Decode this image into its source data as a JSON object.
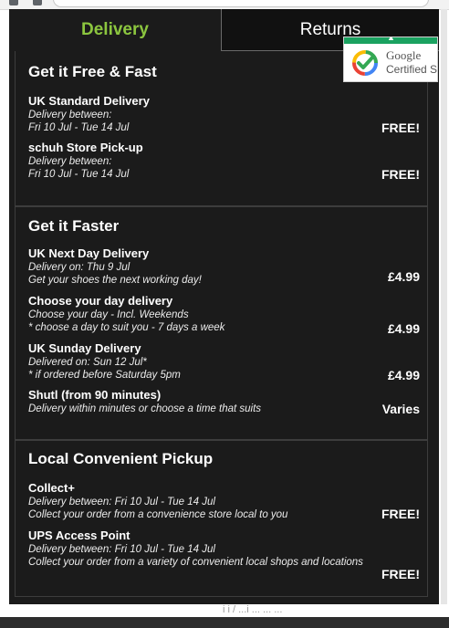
{
  "tabs": {
    "delivery": "Delivery",
    "returns": "Returns"
  },
  "badge": {
    "line1": "Google",
    "line2": "Certified Sh"
  },
  "sections": [
    {
      "title": "Get it Free & Fast",
      "options": [
        {
          "name": "UK Standard Delivery",
          "lines": [
            "Delivery between:",
            "Fri 10 Jul - Tue 14 Jul"
          ],
          "price": "FREE!"
        },
        {
          "name": "schuh Store Pick-up",
          "lines": [
            "Delivery between:",
            "Fri 10 Jul - Tue 14 Jul"
          ],
          "price": "FREE!"
        }
      ]
    },
    {
      "title": "Get it Faster",
      "options": [
        {
          "name": "UK Next Day Delivery",
          "lines": [
            "Delivery on: Thu 9 Jul",
            "Get your shoes the next working day!"
          ],
          "price": "£4.99"
        },
        {
          "name": "Choose your day delivery",
          "lines": [
            "Choose your day - Incl. Weekends",
            "* choose a day to suit you - 7 days a week"
          ],
          "price": "£4.99"
        },
        {
          "name": "UK Sunday Delivery",
          "lines": [
            "Delivered on: Sun 12 Jul*",
            "* if ordered before Saturday 5pm"
          ],
          "price": "£4.99"
        },
        {
          "name": "Shutl (from 90 minutes)",
          "lines": [
            "Delivery within minutes or choose a time that suits"
          ],
          "price": "Varies"
        }
      ]
    },
    {
      "title": "Local Convenient Pickup",
      "options": [
        {
          "name": "Collect+",
          "lines": [
            "Delivery between: Fri 10 Jul - Tue 14 Jul",
            "Collect your order from a convenience store local to you"
          ],
          "price": "FREE!"
        },
        {
          "name": "UPS Access Point",
          "lines": [
            "Delivery between: Fri 10 Jul - Tue 14 Jul",
            "Collect your order from a variety of convenient local shops and locations"
          ],
          "price": "FREE!"
        }
      ]
    }
  ],
  "bottom_text": "i i / ...i  ...  ...   ..."
}
